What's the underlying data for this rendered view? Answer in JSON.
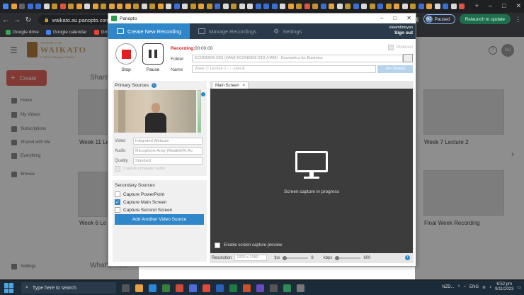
{
  "browser": {
    "url": "waikato.au.panopto.com/Pa",
    "profile_initial": "MJ",
    "profile_status": "Paused",
    "relaunch_label": "Relaunch to update",
    "bookmarks": [
      {
        "label": "Google drive",
        "color": "#34a853"
      },
      {
        "label": "Google calendar",
        "color": "#4285f4"
      },
      {
        "label": "Gmail",
        "color": "#ea4335"
      }
    ]
  },
  "site": {
    "logo_top": "UNIVERSITY OF",
    "logo_name": "WAIKATO",
    "logo_sub": "Te Whare Wānanga o Waikato",
    "create_label": "Create",
    "share_heading": "Share",
    "sidebar": [
      "Home",
      "My Videos",
      "Subscriptions",
      "Shared with Me",
      "Everything",
      "Browse",
      "Settings"
    ],
    "thumbs_left": [
      "Week 11 Le",
      "Week 6 Le"
    ],
    "thumb_right_1": "Week 7 Lecture 2",
    "thumb_right_2": "Final Week Recording",
    "whats_new": "What's New",
    "avatar": "MJ"
  },
  "panopto": {
    "title": "Panopto",
    "nav": {
      "create": "Create New Recording",
      "manage": "Manage Recordings",
      "settings": "Settings"
    },
    "user": "eleamt\\mryan",
    "sign_out": "Sign out",
    "stop_label": "Stop",
    "pause_label": "Pause",
    "recording_label": "Recording:",
    "recording_time": "00:00:00",
    "webcast_label": "Webcast",
    "folder_label": "Folder",
    "folder_value": "ECON5506-23G (HAM) ECON5506-23G (HAM) - Economics for Business",
    "name_label": "Name",
    "name_value": "Week 1: Lecture 1 - - - part A",
    "name_button": "Join Session",
    "primary_sources": {
      "title": "Primary Sources",
      "video_label": "Video",
      "video_value": "Integrated Webcam",
      "audio_label": "Audio",
      "audio_value": "Microphone Array (Realtek(R) Au",
      "quality_label": "Quality",
      "quality_value": "Standard",
      "capture_audio": "Capture computer audio"
    },
    "secondary_sources": {
      "title": "Secondary Sources",
      "items": [
        {
          "label": "Capture PowerPoint",
          "checked": false
        },
        {
          "label": "Capture Main Screen",
          "checked": true
        },
        {
          "label": "Capture Second Screen",
          "checked": false
        }
      ],
      "add_button": "Add Another Video Source"
    },
    "main_tab": "Main Screen",
    "main_tab_close": "×",
    "capture_text": "Screen capture in progress",
    "preview_label": "Enable screen capture preview",
    "resolution_label": "Resolution",
    "resolution_value": "1920 x 1080",
    "fps_label": "fps",
    "fps_value": "8",
    "kbps_label": "kbps",
    "kbps_value": "600"
  },
  "taskbar": {
    "search_placeholder": "Type here to search",
    "weather": "NZD...",
    "language": "ENG",
    "time": "6:52 pm",
    "date": "9/11/2023"
  }
}
